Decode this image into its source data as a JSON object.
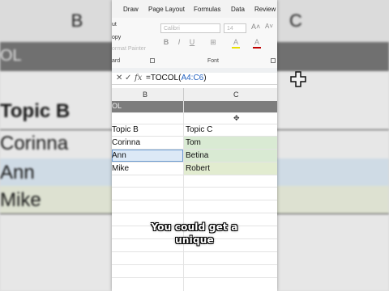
{
  "background": {
    "col_b": "B",
    "col_c": "C",
    "band_text": "OL",
    "rows": [
      "Topic B",
      "Corinna",
      "Ann",
      "Mike"
    ],
    "cursor_icon": "cross-cursor-icon"
  },
  "ribbon": {
    "tabs": [
      "Draw",
      "Page Layout",
      "Formulas",
      "Data",
      "Review"
    ],
    "clipboard": {
      "cut": "ut",
      "copy": "opy",
      "painter": "ormat Painter",
      "group": "ard"
    },
    "font": {
      "family": "Calibri",
      "size": "14",
      "group": "Font"
    },
    "buttons": [
      "B",
      "I",
      "U",
      "⊞",
      "A",
      "A"
    ]
  },
  "formula_bar": {
    "cancel_icon": "✕",
    "enter_icon": "✓",
    "fx": "fx",
    "prefix": "=TOCOL(",
    "range": "A4:C6",
    "suffix": ")"
  },
  "grid": {
    "columns": [
      "B",
      "C"
    ],
    "band_text": "OL",
    "header": [
      "Topic B",
      "Topic C"
    ],
    "rows": [
      [
        "Corinna",
        "Tom"
      ],
      [
        "Ann",
        "Betina"
      ],
      [
        "Mike",
        "Robert"
      ]
    ],
    "colors": {
      "col_b_fill": "#d3e6f4",
      "col_c_fill": "#d9ead3",
      "col_c_row3": "#e2ecd0"
    }
  },
  "caption": {
    "line1": "You could get a",
    "line2": "unique"
  }
}
